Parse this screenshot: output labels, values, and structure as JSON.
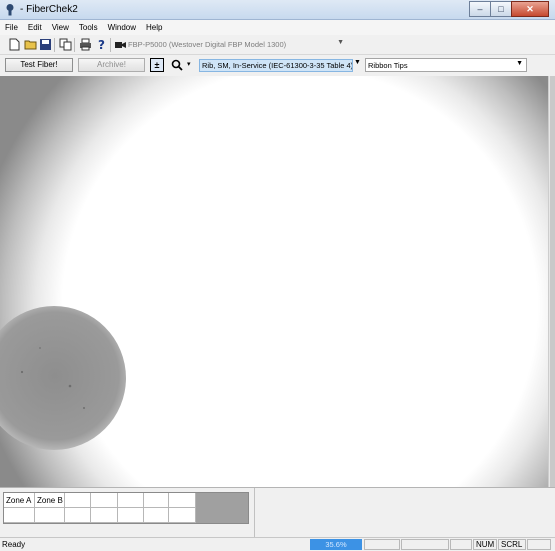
{
  "window": {
    "title": "- FiberChek2",
    "buttons": {
      "minimize": "–",
      "maximize": "□",
      "close": "✕"
    }
  },
  "menu": [
    "File",
    "Edit",
    "View",
    "Tools",
    "Window",
    "Help"
  ],
  "toolbar": {
    "icons": [
      "new-file-icon",
      "open-folder-icon",
      "save-icon",
      "copy-icon",
      "print-icon",
      "help-icon",
      "camera-icon"
    ],
    "device": "FBP-P5000 (Westover Digital FBP Model 1300)"
  },
  "actions": {
    "test_fiber": "Test Fiber!",
    "archive": "Archive!",
    "toggle": "±",
    "profile": "Rib, SM, In-Service (IEC-61300-3-35 Table 4)",
    "tip_type": "Ribbon Tips"
  },
  "zones": {
    "headers": [
      "Zone A",
      "Zone B",
      "",
      "",
      "",
      "",
      ""
    ]
  },
  "status": {
    "text": "Ready",
    "zoom": "35.6%",
    "num": "NUM",
    "scrl": "SCRL"
  },
  "colors": {
    "accent": "#3c92e5",
    "selection": "#cfe4f7"
  }
}
